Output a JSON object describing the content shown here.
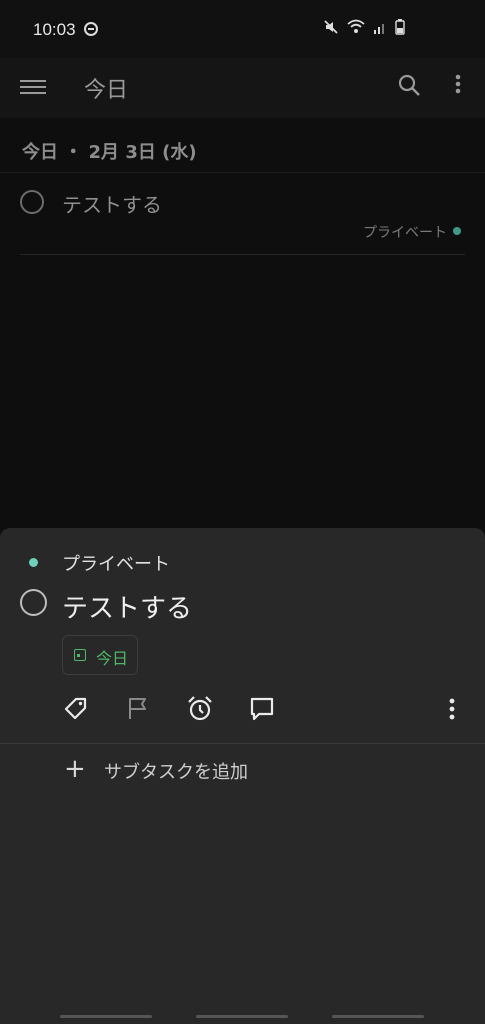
{
  "status_bar": {
    "time": "10:03"
  },
  "app_bar": {
    "title": "今日"
  },
  "list": {
    "section_header": "今日 ・ 2月 3日 (水)",
    "tasks": [
      {
        "title": "テストする",
        "project": "プライベート",
        "project_color": "#3e9a86"
      }
    ]
  },
  "sheet": {
    "project": "プライベート",
    "project_color": "#6fd1bc",
    "title": "テストする",
    "due_label": "今日",
    "due_color": "#4fb86a",
    "add_subtask_label": "サブタスクを追加",
    "action_icons": [
      "label-icon",
      "flag-icon",
      "alarm-icon",
      "comment-icon",
      "more-vertical-icon"
    ]
  }
}
